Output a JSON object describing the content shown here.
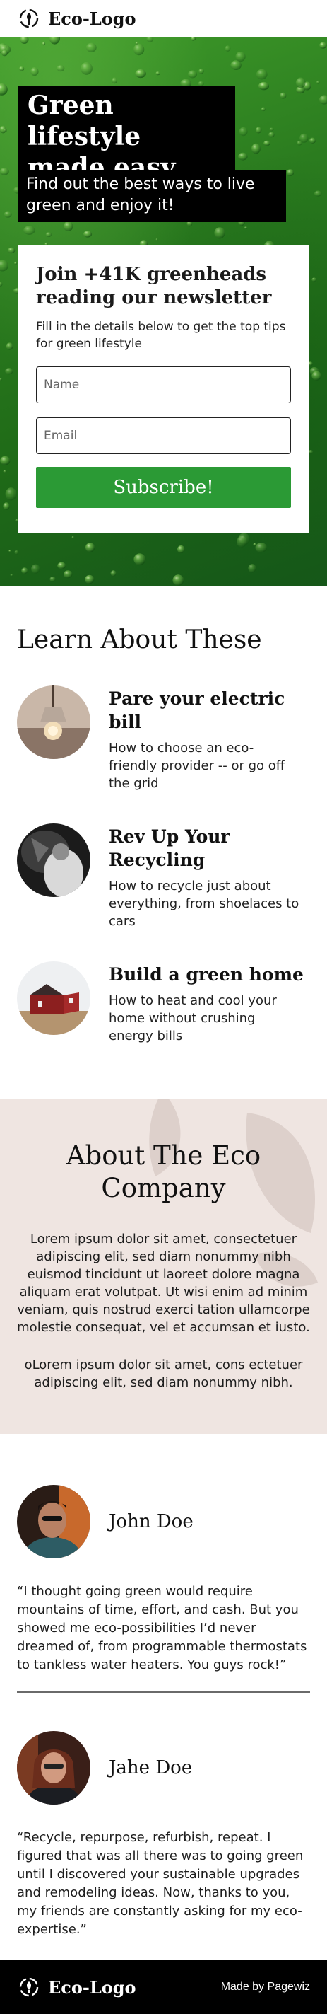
{
  "header": {
    "logo_text": "Eco-Logo",
    "logo_icon": "recycle-leaf-icon"
  },
  "hero": {
    "title": "Green lifestyle made easy",
    "subtitle": "Find out the best ways to live green and enjoy it!",
    "background": "green-water-drops-image"
  },
  "newsletter": {
    "title": "Join +41K greenheads reading our newsletter",
    "description": "Fill in the details below to get the top tips for green lifestyle",
    "name_placeholder": "Name",
    "email_placeholder": "Email",
    "submit_label": "Subscribe!",
    "button_color": "#2b9a35"
  },
  "learn": {
    "title": "Learn About These",
    "items": [
      {
        "title": "Pare your electric bill",
        "description": "How to choose an eco-friendly provider -- or go off the grid",
        "image": "light-bulb-photo"
      },
      {
        "title": "Rev Up Your Recycling",
        "description": "How to recycle just about everything, from shoelaces to cars",
        "image": "person-recycling-photo"
      },
      {
        "title": "Build a green home",
        "description": "How to heat and cool your home without crushing energy bills",
        "image": "red-house-photo"
      }
    ]
  },
  "about": {
    "title": "About The Eco Company",
    "paragraph1": "Lorem ipsum dolor sit amet, consectetuer adipiscing elit, sed diam nonummy nibh euismod tincidunt ut laoreet dolore magna aliquam erat volutpat. Ut wisi enim ad minim veniam, quis nostrud exerci tation ullamcorpe molestie consequat, vel et accumsan et iusto.",
    "paragraph2": "oLorem ipsum dolor sit amet, cons ectetuer adipiscing elit, sed diam nonummy nibh.",
    "background_color": "#efe5e1"
  },
  "testimonials": [
    {
      "name": "John Doe",
      "quote": "“I thought going green would require mountains of time, effort, and cash. But you showed me eco-possibilities I’d never dreamed of, from programmable thermostats to tankless water heaters. You guys rock!”"
    },
    {
      "name": "Jahe Doe",
      "quote": "“Recycle, repurpose, refurbish, repeat. I figured that was all there was to going green until I discovered your sustainable upgrades and remodeling ideas. Now, thanks to you, my friends are constantly asking for my eco-expertise.”"
    }
  ],
  "footer": {
    "logo_text": "Eco-Logo",
    "made_by": "Made by Pagewiz"
  }
}
